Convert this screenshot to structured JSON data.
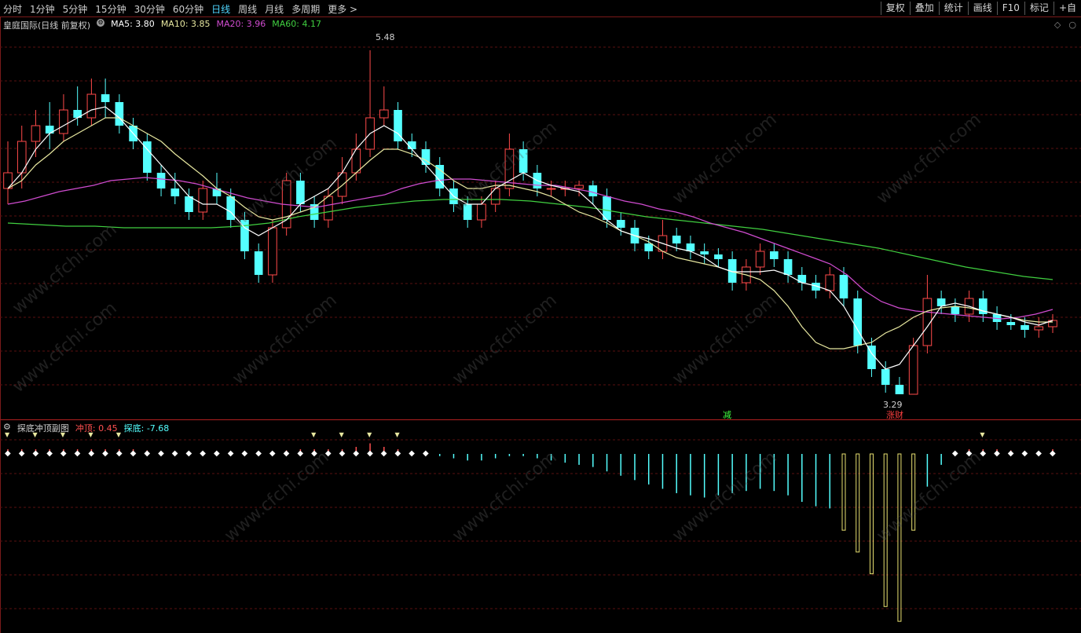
{
  "toolbar": {
    "periods": [
      "分时",
      "1分钟",
      "5分钟",
      "15分钟",
      "30分钟",
      "60分钟",
      "日线",
      "周线",
      "月线",
      "多周期",
      "更多 >"
    ],
    "active_period": "日线",
    "tools": [
      "复权",
      "叠加",
      "统计",
      "画线",
      "F10",
      "标记",
      "+自"
    ]
  },
  "main_legend": {
    "title": "皇庭国际(日线 前复权)",
    "ma5": "MA5: 3.80",
    "ma10": "MA10: 3.85",
    "ma20": "MA20: 3.96",
    "ma60": "MA60: 4.17",
    "colors": {
      "ma5": "#ffffff",
      "ma10": "#e8e8a0",
      "ma20": "#d04cd0",
      "ma60": "#40d040"
    }
  },
  "corner_icons": [
    "◇",
    "○"
  ],
  "markers": {
    "high": "5.48",
    "low": "3.29",
    "tag_green": "减",
    "tag_red": "涨财"
  },
  "sub_legend": {
    "title": "探底冲顶副图",
    "top_label": "冲顶:",
    "top_value": "0.45",
    "bottom_label": "探底:",
    "bottom_value": "-7.68"
  },
  "watermark": "www.cfchi.com",
  "chart_data": {
    "type": "candlestick",
    "title": "皇庭国际(日线 前复权)",
    "y_range": [
      3.2,
      5.6
    ],
    "colors": {
      "up": "#ff4a4a",
      "down": "#54ffff",
      "ma5": "#ffffff",
      "ma10": "#e8e8a0",
      "ma20": "#d04cd0",
      "ma60": "#40d040"
    },
    "candles": [
      [
        4.6,
        4.7,
        4.9,
        4.5
      ],
      [
        4.7,
        4.9,
        5.0,
        4.6
      ],
      [
        4.9,
        5.0,
        5.1,
        4.8
      ],
      [
        5.0,
        4.95,
        5.15,
        4.85
      ],
      [
        4.95,
        5.1,
        5.2,
        4.9
      ],
      [
        5.1,
        5.05,
        5.25,
        5.0
      ],
      [
        5.05,
        5.2,
        5.3,
        5.0
      ],
      [
        5.2,
        5.15,
        5.3,
        5.05
      ],
      [
        5.15,
        5.0,
        5.2,
        4.95
      ],
      [
        5.0,
        4.9,
        5.05,
        4.85
      ],
      [
        4.9,
        4.7,
        4.95,
        4.65
      ],
      [
        4.7,
        4.6,
        4.75,
        4.55
      ],
      [
        4.6,
        4.55,
        4.7,
        4.5
      ],
      [
        4.55,
        4.45,
        4.6,
        4.4
      ],
      [
        4.45,
        4.6,
        4.65,
        4.4
      ],
      [
        4.6,
        4.55,
        4.7,
        4.5
      ],
      [
        4.55,
        4.4,
        4.6,
        4.35
      ],
      [
        4.4,
        4.2,
        4.45,
        4.15
      ],
      [
        4.2,
        4.05,
        4.25,
        4.0
      ],
      [
        4.05,
        4.35,
        4.4,
        4.0
      ],
      [
        4.35,
        4.65,
        4.7,
        4.3
      ],
      [
        4.65,
        4.5,
        4.7,
        4.45
      ],
      [
        4.5,
        4.4,
        4.55,
        4.35
      ],
      [
        4.4,
        4.55,
        4.6,
        4.35
      ],
      [
        4.55,
        4.7,
        4.8,
        4.5
      ],
      [
        4.7,
        4.85,
        4.95,
        4.65
      ],
      [
        4.85,
        5.05,
        5.48,
        4.8
      ],
      [
        5.05,
        5.1,
        5.25,
        5.0
      ],
      [
        5.1,
        4.9,
        5.15,
        4.85
      ],
      [
        4.9,
        4.85,
        4.95,
        4.8
      ],
      [
        4.85,
        4.75,
        4.9,
        4.7
      ],
      [
        4.75,
        4.6,
        4.8,
        4.55
      ],
      [
        4.6,
        4.5,
        4.65,
        4.45
      ],
      [
        4.5,
        4.4,
        4.55,
        4.35
      ],
      [
        4.4,
        4.5,
        4.55,
        4.35
      ],
      [
        4.5,
        4.6,
        4.65,
        4.45
      ],
      [
        4.6,
        4.85,
        4.95,
        4.55
      ],
      [
        4.85,
        4.7,
        4.9,
        4.65
      ],
      [
        4.7,
        4.6,
        4.75,
        4.55
      ],
      [
        4.6,
        4.6,
        4.65,
        4.55
      ],
      [
        4.6,
        4.6,
        4.65,
        4.55
      ],
      [
        4.6,
        4.62,
        4.65,
        4.55
      ],
      [
        4.62,
        4.55,
        4.65,
        4.5
      ],
      [
        4.55,
        4.4,
        4.6,
        4.35
      ],
      [
        4.4,
        4.35,
        4.45,
        4.3
      ],
      [
        4.35,
        4.25,
        4.4,
        4.2
      ],
      [
        4.25,
        4.2,
        4.3,
        4.15
      ],
      [
        4.2,
        4.3,
        4.4,
        4.15
      ],
      [
        4.3,
        4.25,
        4.35,
        4.2
      ],
      [
        4.25,
        4.2,
        4.3,
        4.15
      ],
      [
        4.2,
        4.18,
        4.25,
        4.12
      ],
      [
        4.18,
        4.15,
        4.22,
        4.1
      ],
      [
        4.15,
        4.0,
        4.2,
        3.95
      ],
      [
        4.0,
        4.1,
        4.15,
        3.95
      ],
      [
        4.1,
        4.2,
        4.25,
        4.05
      ],
      [
        4.2,
        4.15,
        4.25,
        4.1
      ],
      [
        4.15,
        4.05,
        4.2,
        4.0
      ],
      [
        4.05,
        4.0,
        4.1,
        3.95
      ],
      [
        4.0,
        3.95,
        4.05,
        3.9
      ],
      [
        3.95,
        4.05,
        4.1,
        3.9
      ],
      [
        4.05,
        3.9,
        4.1,
        3.85
      ],
      [
        3.9,
        3.6,
        3.95,
        3.55
      ],
      [
        3.6,
        3.45,
        3.65,
        3.4
      ],
      [
        3.45,
        3.35,
        3.5,
        3.3
      ],
      [
        3.35,
        3.29,
        3.4,
        3.29
      ],
      [
        3.29,
        3.6,
        3.65,
        3.29
      ],
      [
        3.6,
        3.9,
        4.05,
        3.55
      ],
      [
        3.9,
        3.85,
        3.95,
        3.8
      ],
      [
        3.85,
        3.8,
        3.9,
        3.75
      ],
      [
        3.8,
        3.9,
        3.95,
        3.75
      ],
      [
        3.9,
        3.8,
        3.95,
        3.75
      ],
      [
        3.8,
        3.75,
        3.85,
        3.7
      ],
      [
        3.75,
        3.73,
        3.8,
        3.7
      ],
      [
        3.73,
        3.7,
        3.78,
        3.65
      ],
      [
        3.7,
        3.72,
        3.78,
        3.65
      ],
      [
        3.72,
        3.76,
        3.8,
        3.68
      ]
    ],
    "ma5": [
      4.6,
      4.7,
      4.85,
      4.95,
      5.0,
      5.05,
      5.1,
      5.12,
      5.05,
      4.95,
      4.85,
      4.75,
      4.65,
      4.55,
      4.5,
      4.5,
      4.45,
      4.35,
      4.3,
      4.35,
      4.4,
      4.5,
      4.55,
      4.6,
      4.7,
      4.85,
      4.95,
      5.0,
      4.95,
      4.85,
      4.75,
      4.65,
      4.55,
      4.5,
      4.5,
      4.6,
      4.65,
      4.7,
      4.65,
      4.62,
      4.6,
      4.58,
      4.5,
      4.4,
      4.33,
      4.3,
      4.28,
      4.25,
      4.22,
      4.2,
      4.16,
      4.1,
      4.07,
      4.07,
      4.07,
      4.08,
      4.05,
      4.0,
      3.98,
      3.95,
      3.85,
      3.7,
      3.55,
      3.45,
      3.48,
      3.6,
      3.72,
      3.85,
      3.87,
      3.85,
      3.82,
      3.8,
      3.78,
      3.75,
      3.73,
      3.76
    ],
    "ma10": [
      4.6,
      4.65,
      4.75,
      4.82,
      4.9,
      4.95,
      5.0,
      5.05,
      5.05,
      5.0,
      4.95,
      4.9,
      4.82,
      4.75,
      4.68,
      4.6,
      4.55,
      4.48,
      4.42,
      4.4,
      4.42,
      4.45,
      4.48,
      4.55,
      4.62,
      4.7,
      4.78,
      4.85,
      4.85,
      4.82,
      4.78,
      4.72,
      4.65,
      4.6,
      4.6,
      4.62,
      4.62,
      4.6,
      4.58,
      4.55,
      4.5,
      4.45,
      4.42,
      4.38,
      4.33,
      4.3,
      4.26,
      4.2,
      4.16,
      4.14,
      4.12,
      4.1,
      4.07,
      4.05,
      4.02,
      3.95,
      3.85,
      3.72,
      3.62,
      3.58,
      3.58,
      3.6,
      3.62,
      3.68,
      3.72,
      3.78,
      3.82,
      3.84,
      3.85,
      3.84,
      3.82,
      3.8,
      3.78,
      3.76,
      3.75,
      3.75
    ],
    "ma20": [
      4.5,
      4.52,
      4.55,
      4.58,
      4.6,
      4.62,
      4.65,
      4.66,
      4.67,
      4.66,
      4.65,
      4.63,
      4.6,
      4.57,
      4.54,
      4.52,
      4.5,
      4.49,
      4.48,
      4.5,
      4.52,
      4.54,
      4.56,
      4.6,
      4.63,
      4.65,
      4.66,
      4.66,
      4.65,
      4.64,
      4.63,
      4.62,
      4.62,
      4.6,
      4.58,
      4.55,
      4.52,
      4.5,
      4.47,
      4.45,
      4.42,
      4.38,
      4.35,
      4.32,
      4.28,
      4.24,
      4.2,
      4.16,
      4.12,
      4.05,
      3.95,
      3.88,
      3.84,
      3.82,
      3.81,
      3.8,
      3.79,
      3.78,
      3.77,
      3.78,
      3.8,
      3.83
    ],
    "ma60": [
      4.38,
      4.37,
      4.36,
      4.36,
      4.35,
      4.35,
      4.35,
      4.35,
      4.36,
      4.38,
      4.42,
      4.45,
      4.48,
      4.5,
      4.52,
      4.53,
      4.53,
      4.53,
      4.52,
      4.5,
      4.48,
      4.45,
      4.42,
      4.4,
      4.38,
      4.36,
      4.34,
      4.31,
      4.28,
      4.25,
      4.22,
      4.18,
      4.14,
      4.1,
      4.07,
      4.04,
      4.02
    ],
    "sub": {
      "y_range": [
        -8,
        0.6
      ],
      "top_value": 0.45,
      "bottom_value": -7.68,
      "bars": [
        0.2,
        0.2,
        0.2,
        0.2,
        0.2,
        0.2,
        0.2,
        0.2,
        0.2,
        0.2,
        0.15,
        0.1,
        0.05,
        0.05,
        0.1,
        0.1,
        0.05,
        0.05,
        0.05,
        0.1,
        0.15,
        0.2,
        0.2,
        0.2,
        0.2,
        0.3,
        0.45,
        0.3,
        0.2,
        0.1,
        0.05,
        -0.1,
        -0.2,
        -0.3,
        -0.3,
        -0.2,
        -0.1,
        -0.1,
        -0.2,
        -0.3,
        -0.4,
        -0.5,
        -0.6,
        -0.8,
        -1.0,
        -1.2,
        -1.4,
        -1.6,
        -1.8,
        -1.9,
        -2.0,
        -1.9,
        -1.8,
        -1.7,
        -1.6,
        -1.7,
        -1.9,
        -2.2,
        -2.4,
        -2.5,
        -3.5,
        -4.5,
        -5.5,
        -7.0,
        -7.68,
        -3.5,
        -1.5,
        -0.5,
        0.1,
        0.2,
        0.2,
        0.2,
        0.15,
        0.1,
        0.1,
        0.2
      ]
    }
  }
}
